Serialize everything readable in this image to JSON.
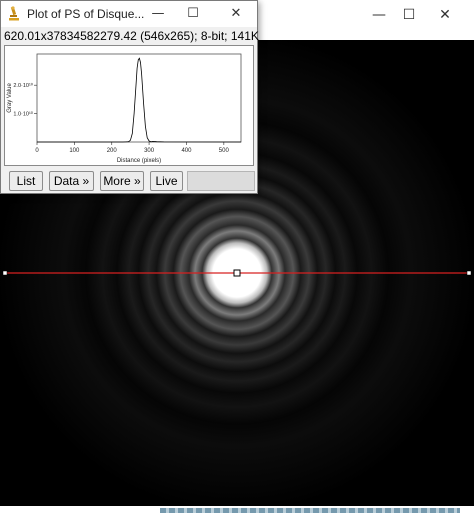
{
  "plot_window": {
    "title": "Plot of PS of Disque...",
    "info": "620.01x37834582279.42  (546x265); 8-bit; 141K",
    "buttons": {
      "list": "List",
      "data": "Data »",
      "more": "More »",
      "live": "Live"
    },
    "window_controls": {
      "minimize": "—",
      "maximize": "☐",
      "close": "✕"
    }
  },
  "main_window": {
    "window_controls": {
      "minimize": "—",
      "maximize": "☐",
      "close": "✕"
    }
  },
  "chart_data": {
    "type": "line",
    "xlabel": "Distance (pixels)",
    "ylabel": "Gray Value",
    "x_ticks": [
      "0",
      "100",
      "200",
      "300",
      "400",
      "500"
    ],
    "y_ticks": [
      "2.0·10¹⁰",
      "1.0·10¹⁰"
    ],
    "xlim": [
      0,
      546
    ],
    "ylim": [
      0,
      31000000000
    ],
    "series": [
      {
        "x": [
          0,
          100,
          200,
          230,
          245,
          250,
          255,
          260,
          265,
          268,
          271,
          274,
          277,
          280,
          285,
          290,
          295,
          300,
          305,
          310,
          320,
          340,
          546
        ],
        "y": [
          0,
          0,
          0,
          0,
          100000000,
          600000000,
          3000000000,
          10000000000,
          20000000000,
          26000000000,
          29000000000,
          29500000000,
          28000000000,
          24000000000,
          14000000000,
          5500000000,
          1500000000,
          350000000,
          80000000,
          200000000,
          120000000,
          50000000,
          0
        ]
      }
    ]
  },
  "colors": {
    "profile_line": "#d62020",
    "image_background": "#000000",
    "plot_line": "#000000"
  },
  "image": {
    "description_type": "airy-disk"
  }
}
